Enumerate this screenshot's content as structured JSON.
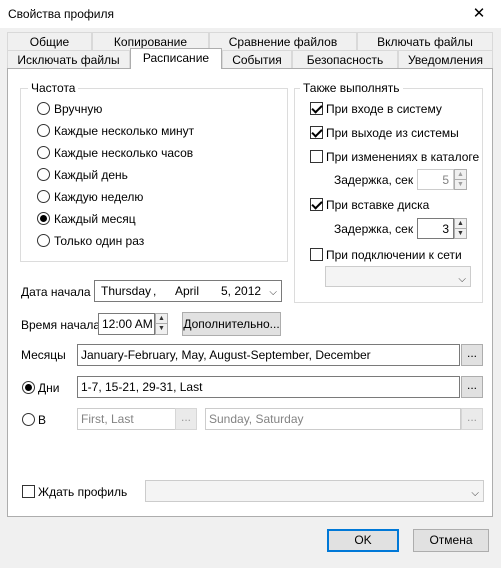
{
  "window": {
    "title": "Свойства профиля",
    "close_glyph": "✕"
  },
  "tabs_row1": [
    "Общие",
    "Копирование",
    "Сравнение файлов",
    "Включать файлы"
  ],
  "tabs_row2": [
    "Исключать файлы",
    "Расписание",
    "События",
    "Безопасность",
    "Уведомления"
  ],
  "frequency": {
    "label": "Частота",
    "options": [
      "Вручную",
      "Каждые несколько минут",
      "Каждые несколько часов",
      "Каждый день",
      "Каждую неделю",
      "Каждый месяц",
      "Только один раз"
    ],
    "selected": "Каждый месяц"
  },
  "also_run": {
    "label": "Также выполнять",
    "on_login": "При входе в систему",
    "on_logout": "При выходе из системы",
    "on_dir_change": "При изменениях в каталоге",
    "delay_label": "Задержка, сек",
    "delay1_value": "5",
    "on_disk_insert": "При вставке диска",
    "delay2_value": "3",
    "on_network_connect": "При подключении к сети"
  },
  "start_date": {
    "label": "Дата начала",
    "weekday": "Thursday",
    "sep": ",",
    "month": "April",
    "day_year": "5, 2012"
  },
  "start_time": {
    "label": "Время начала",
    "value": "12:00 AM",
    "advanced_button": "Дополнительно..."
  },
  "months": {
    "label": "Месяцы",
    "value": "January-February, May, August-September, December",
    "browse": "..."
  },
  "days": {
    "label": "Дни",
    "value": "1-7, 15-21, 29-31, Last",
    "browse": "..."
  },
  "in": {
    "label": "В",
    "ordinal_value": "First, Last",
    "weekday_value": "Sunday, Saturday",
    "browse": "..."
  },
  "wait_profile": {
    "label": "Ждать профиль"
  },
  "buttons": {
    "ok": "OK",
    "cancel": "Отмена"
  },
  "icons": {
    "spin_up": "▲",
    "spin_down": "▼",
    "dropdown": "⌵"
  }
}
